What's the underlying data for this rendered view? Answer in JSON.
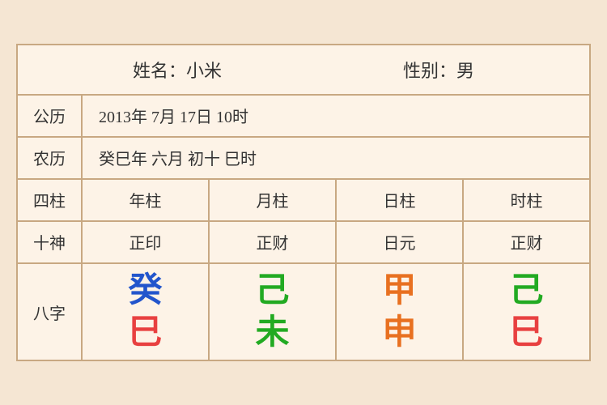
{
  "header": {
    "name_label": "姓名：小米",
    "gender_label": "性别：男"
  },
  "gongli": {
    "label": "公历",
    "content": "2013年 7月 17日 10时"
  },
  "nongli": {
    "label": "农历",
    "content": "癸巳年 六月 初十 巳时"
  },
  "sizhu": {
    "label": "四柱",
    "cols": [
      "年柱",
      "月柱",
      "日柱",
      "时柱"
    ]
  },
  "shishen": {
    "label": "十神",
    "cols": [
      "正印",
      "正财",
      "日元",
      "正财"
    ]
  },
  "bazhi": {
    "label": "八字",
    "cols": [
      {
        "top": "癸",
        "bottom": "巳",
        "top_color": "blue",
        "bottom_color": "red"
      },
      {
        "top": "己",
        "bottom": "未",
        "top_color": "green",
        "bottom_color": "green"
      },
      {
        "top": "甲",
        "bottom": "申",
        "top_color": "orange",
        "bottom_color": "orange"
      },
      {
        "top": "己",
        "bottom": "巳",
        "top_color": "green",
        "bottom_color": "red"
      }
    ]
  }
}
